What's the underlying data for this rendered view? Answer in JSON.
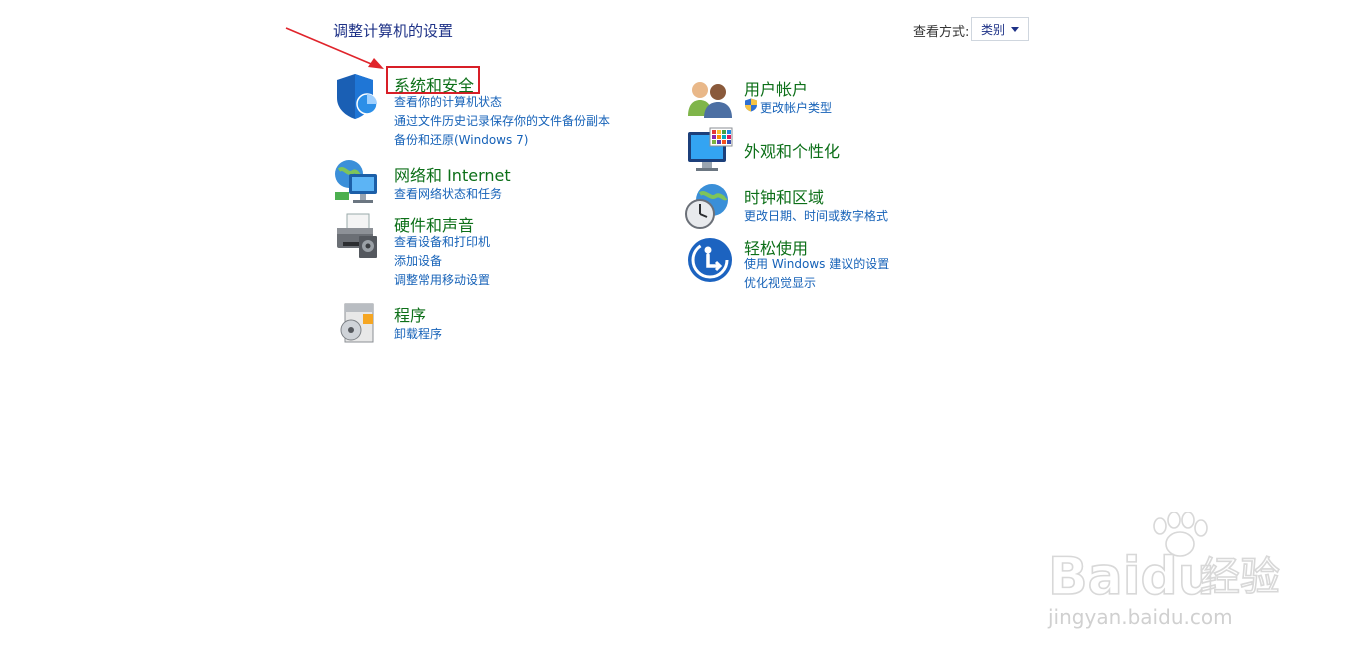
{
  "header": {
    "title": "调整计算机的设置",
    "view_label": "查看方式:",
    "view_value": "类别"
  },
  "categories": [
    {
      "title": "系统和安全",
      "links": [
        "查看你的计算机状态",
        "通过文件历史记录保存你的文件备份副本",
        "备份和还原(Windows 7)"
      ],
      "icon": "shield-icon"
    },
    {
      "title": "网络和 Internet",
      "links": [
        "查看网络状态和任务"
      ],
      "icon": "network-icon"
    },
    {
      "title": "硬件和声音",
      "links": [
        "查看设备和打印机",
        "添加设备",
        "调整常用移动设置"
      ],
      "icon": "printer-icon"
    },
    {
      "title": "程序",
      "links": [
        "卸载程序"
      ],
      "icon": "programs-icon"
    },
    {
      "title": "用户帐户",
      "links": [
        "更改帐户类型"
      ],
      "icon": "users-icon"
    },
    {
      "title": "外观和个性化",
      "links": [],
      "icon": "monitor-palette-icon"
    },
    {
      "title": "时钟和区域",
      "links": [
        "更改日期、时间或数字格式"
      ],
      "icon": "clock-globe-icon"
    },
    {
      "title": "轻松使用",
      "links": [
        "使用 Windows 建议的设置",
        "优化视觉显示"
      ],
      "icon": "accessibility-icon"
    }
  ],
  "watermark": {
    "brand": "Baidu",
    "brand_cn": "经验",
    "url": "jingyan.baidu.com"
  },
  "colors": {
    "title_blue": "#1e3287",
    "category_green": "#0c6f18",
    "link_blue": "#1662b8",
    "highlight_red": "#d81e27"
  }
}
